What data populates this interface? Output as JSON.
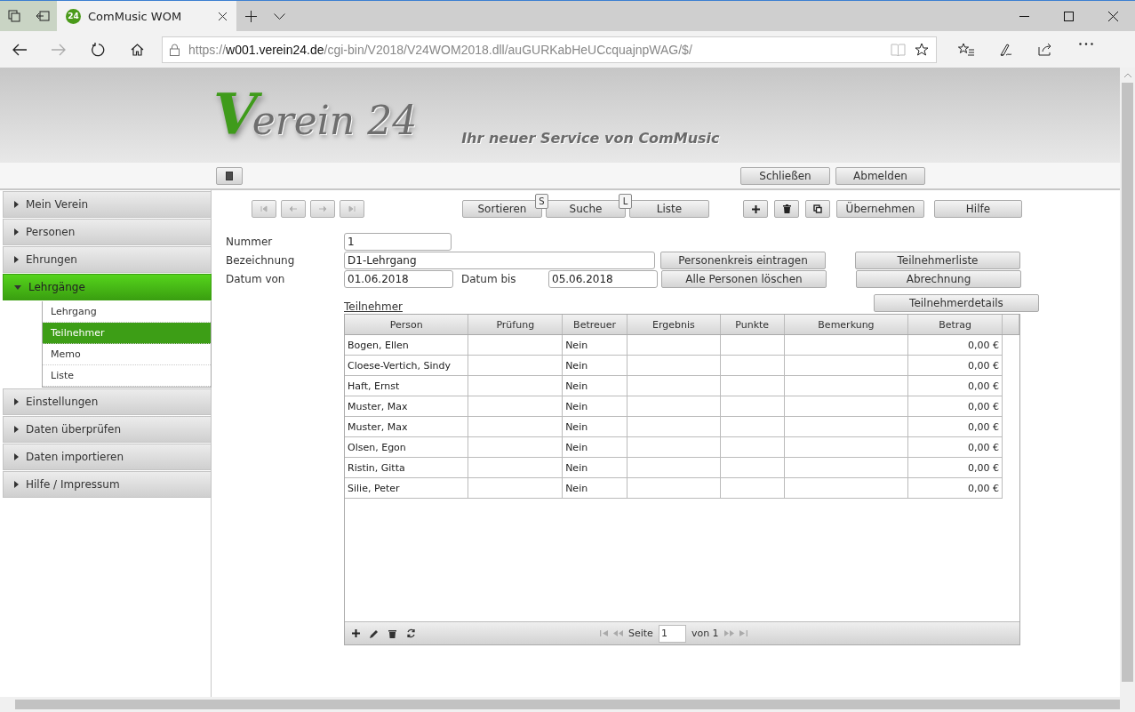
{
  "browser": {
    "tab_title": "ComMusic WOM",
    "tab_badge": "24",
    "url_scheme": "https://",
    "url_host": "w001.verein24.de",
    "url_path": "/cgi-bin/V2018/V24WOM2018.dll/auGURKabHeUCcquajnpWAG/$/"
  },
  "header": {
    "logo_initial": "V",
    "logo_text": "erein 24",
    "tagline": "Ihr neuer Service von ComMusic"
  },
  "top_buttons": [
    "Schließen",
    "Abmelden"
  ],
  "sidebar": {
    "items": [
      {
        "label": "Mein Verein",
        "expanded": false
      },
      {
        "label": "Personen",
        "expanded": false
      },
      {
        "label": "Ehrungen",
        "expanded": false
      },
      {
        "label": "Lehrgänge",
        "expanded": true,
        "children": [
          {
            "label": "Lehrgang",
            "selected": false
          },
          {
            "label": "Teilnehmer",
            "selected": true
          },
          {
            "label": "Memo",
            "selected": false
          },
          {
            "label": "Liste",
            "selected": false
          }
        ]
      },
      {
        "label": "Einstellungen",
        "expanded": false
      },
      {
        "label": "Daten überprüfen",
        "expanded": false
      },
      {
        "label": "Daten importieren",
        "expanded": false
      },
      {
        "label": "Hilfe / Impressum",
        "expanded": false
      }
    ]
  },
  "toolbar": {
    "views": [
      {
        "label": "Sortieren"
      },
      {
        "label": "Suche",
        "hotkey": "S"
      },
      {
        "label": "Liste",
        "hotkey": "L"
      }
    ],
    "actions": [
      "Übernehmen",
      "Hilfe"
    ]
  },
  "form": {
    "nummer": {
      "label": "Nummer",
      "value": "1"
    },
    "bezeichnung": {
      "label": "Bezeichnung",
      "value": "D1-Lehrgang"
    },
    "datum_von": {
      "label": "Datum von",
      "value": "01.06.2018"
    },
    "datum_bis": {
      "label": "Datum bis",
      "value": "05.06.2018"
    },
    "middle_buttons": [
      "Personenkreis eintragen",
      "Alle Personen löschen"
    ],
    "right_buttons": [
      "Teilnehmerliste",
      "Abrechnung",
      "Teilnehmerdetails"
    ]
  },
  "grid": {
    "title": "Teilnehmer",
    "columns": [
      {
        "label": "Person",
        "kind": "text"
      },
      {
        "label": "Prüfung",
        "kind": "text"
      },
      {
        "label": "Betreuer",
        "kind": "text"
      },
      {
        "label": "Ergebnis",
        "kind": "text"
      },
      {
        "label": "Punkte",
        "kind": "text"
      },
      {
        "label": "Bemerkung",
        "kind": "text"
      },
      {
        "label": "Betrag",
        "kind": "amount"
      }
    ],
    "rows": [
      [
        "Bogen, Ellen",
        null,
        "Nein",
        null,
        null,
        null,
        "0,00 €"
      ],
      [
        "Cloese-Vertich, Sindy",
        null,
        "Nein",
        null,
        null,
        null,
        "0,00 €"
      ],
      [
        "Haft, Ernst",
        null,
        "Nein",
        null,
        null,
        null,
        "0,00 €"
      ],
      [
        "Muster, Max",
        null,
        "Nein",
        null,
        null,
        null,
        "0,00 €"
      ],
      [
        "Muster, Max",
        null,
        "Nein",
        null,
        null,
        null,
        "0,00 €"
      ],
      [
        "Olsen, Egon",
        null,
        "Nein",
        null,
        null,
        null,
        "0,00 €"
      ],
      [
        "Ristin, Gitta",
        null,
        "Nein",
        null,
        null,
        null,
        "0,00 €"
      ],
      [
        "Silie, Peter",
        null,
        "Nein",
        null,
        null,
        null,
        "0,00 €"
      ]
    ],
    "pager": {
      "page_label": "Seite",
      "page": "1",
      "of_label": "von 1"
    }
  }
}
